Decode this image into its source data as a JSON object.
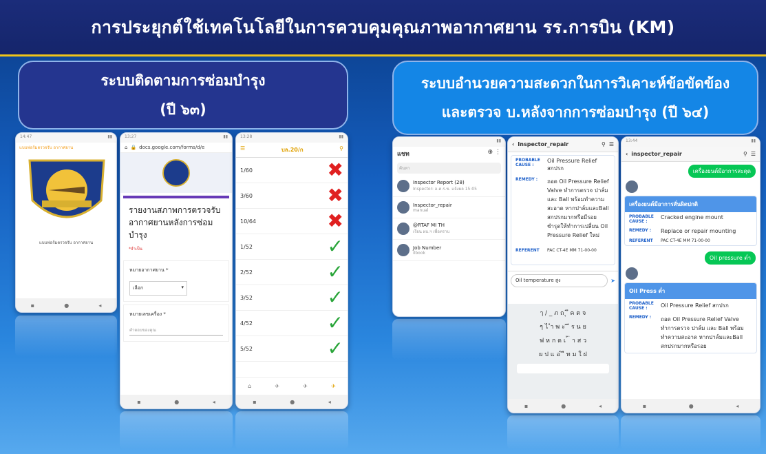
{
  "title": "การประยุกต์ใช้เทคโนโลยีในการควบคุมคุณภาพอากาศยาน รร.การบิน (KM)",
  "left_panel": {
    "line1": "ระบบติดตามการซ่อมบำรุง",
    "line2": "(ปี ๖๓)"
  },
  "right_panel": {
    "line1": "ระบบอำนวยความสะดวกในการวิเคาะห์ข้อขัดข้อง",
    "line2": "และตรวจ บ.หลังจากการซ่อมบำรุง (ปี ๖๔)"
  },
  "phone1": {
    "time": "14:47",
    "label": "แบบฟอร์มตรวจรับ อากาศยาน",
    "caption": "แบบฟอร์มตรวจรับ อากาศยาน"
  },
  "phone2": {
    "time": "13:27",
    "url": "docs.google.com/forms/d/e",
    "form_title": "รายงานสภาพการตรวจรับอากาศยานหลังการซ่อมบำรุง",
    "required": "*จำเป็น",
    "field1": "หมายอากาศยาน *",
    "field1_value": "เลือก",
    "field2": "หมายเลขเครื่อง *",
    "field2_ph": "คำตอบของคุณ"
  },
  "phone3": {
    "time": "13:28",
    "header": "บล.20/ก",
    "rows": [
      {
        "label": "1/60",
        "status": "x"
      },
      {
        "label": "3/60",
        "status": "x"
      },
      {
        "label": "10/64",
        "status": "x"
      },
      {
        "label": "1/52",
        "status": "ok"
      },
      {
        "label": "2/52",
        "status": "ok"
      },
      {
        "label": "3/52",
        "status": "ok"
      },
      {
        "label": "4/52",
        "status": "ok"
      },
      {
        "label": "5/52",
        "status": "ok"
      }
    ]
  },
  "phone4": {
    "header": "แชท",
    "search": "ค้นหา",
    "items": [
      {
        "name": "Inspector Report (28)",
        "sub": "Inspector: อ.ค.ร.ข. แจ้งผล 15:05"
      },
      {
        "name": "Inspector_repair",
        "sub": "manual"
      },
      {
        "name": "@RTAF MI TH",
        "sub": "เรียน ผบ.ฯ เพื่อทราบ"
      },
      {
        "name": "Job Number",
        "sub": "ilbook"
      }
    ]
  },
  "phone5": {
    "header": "Inspector_repair",
    "cause": "Oil Pressure Relief สกปรก",
    "remedy": "ถอด Oil Pressure Relief Valve ทำการตรวจ ปาล์ม และ Ball พร้อมทำความสะอาด หากปาล์มและBall สกปรกมากหรือมีรอย ชำรุดให้ทำการเปลี่ยน Oil Pressure Relief ใหม่",
    "ref": "PAC CT-4E MM 71-00-00",
    "input": "Oil temperature สูง"
  },
  "phone6": {
    "time": "13:44",
    "header": "inspector_repair",
    "msg1": "เครื่องยนต์มีอาการสะดุด",
    "card1_title": "เครื่องยนต์มีอาการสั่นผิดปกติ",
    "card1_cause": "Cracked engine mount",
    "card1_remedy": "Replace or repair mounting",
    "card1_ref": "PAC CT-4E MM 71-00-00",
    "msg2": "Oil pressure ต่ำ",
    "card2_title": "Oil Press ต่ำ",
    "card2_cause": "Oil Pressure Relief สกปรก",
    "card2_remedy": "ถอด Oil Pressure Relief Valve ทำการตรวจ ปาล์ม และ Ball พร้อมทำความสะอาด หากปาล์มและBall สกปรกมากหรือรอย"
  },
  "labels": {
    "cause": "PROBABLE CAUSE :",
    "remedy": "REMEDY :",
    "ref": "REFERENT"
  },
  "colors": {
    "title_bg": "#1b2c7a",
    "accent_yellow": "#f0c419",
    "left_panel": "#24358f",
    "right_panel": "#1486e6"
  }
}
